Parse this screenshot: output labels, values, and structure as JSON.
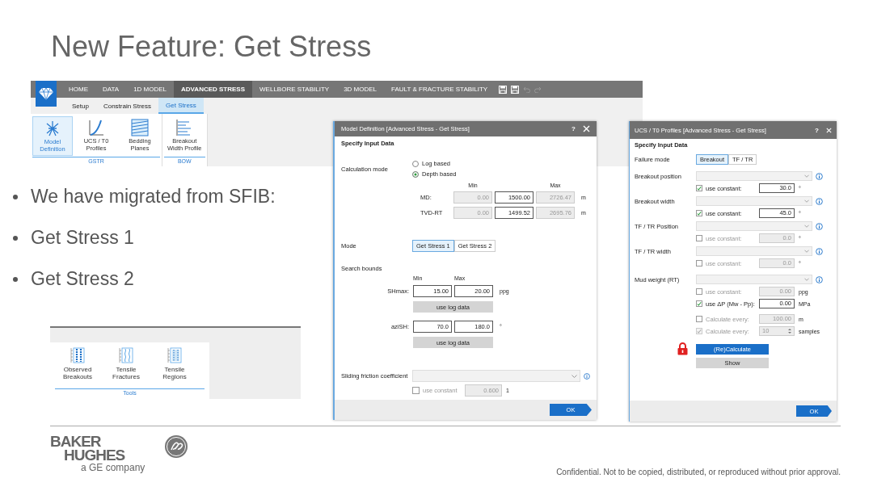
{
  "title": "New Feature: Get Stress",
  "bullets": [
    "We have migrated from SFIB:",
    "Get Stress 1",
    "Get Stress 2"
  ],
  "ribbon": {
    "tabs": [
      {
        "label": "HOME",
        "selected": false
      },
      {
        "label": "DATA",
        "selected": false
      },
      {
        "label": "1D MODEL",
        "selected": false
      },
      {
        "label": "ADVANCED STRESS",
        "selected": true
      },
      {
        "label": "WELLBORE STABILITY",
        "selected": false
      },
      {
        "label": "3D MODEL",
        "selected": false
      },
      {
        "label": "FAULT & FRACTURE STABILITY",
        "selected": false
      }
    ],
    "subtabs": [
      {
        "label": "Setup",
        "selected": false
      },
      {
        "label": "Constrain Stress",
        "selected": false
      },
      {
        "label": "Get Stress",
        "selected": true
      }
    ],
    "groups": [
      {
        "label": "GSTR",
        "items": [
          {
            "label": "Model\nDefinition",
            "kind": "model",
            "selected": true
          },
          {
            "label": "UCS / T0\nProfiles",
            "kind": "curve",
            "selected": false
          },
          {
            "label": "Bedding\nPlanes",
            "kind": "planes",
            "selected": false
          }
        ]
      },
      {
        "label": "BOW",
        "items": [
          {
            "label": "Breakout\nWidth Profile",
            "kind": "profile",
            "selected": false
          }
        ]
      }
    ]
  },
  "tools": {
    "label": "Tools",
    "items": [
      {
        "label": "Observed\nBreakouts",
        "kind": "breakouts"
      },
      {
        "label": "Tensile\nFractures",
        "kind": "fractures"
      },
      {
        "label": "Tensile\nRegions",
        "kind": "regions"
      }
    ]
  },
  "model_dialog": {
    "title": "Model Definition [Advanced Stress - Get Stress]",
    "help": "?",
    "heading": "Specify Input Data",
    "calc_label": "Calculation mode",
    "calc_options": [
      {
        "label": "Log based",
        "selected": false
      },
      {
        "label": "Depth based",
        "selected": true
      }
    ],
    "depth_headers": [
      "Min",
      "Max"
    ],
    "depth_rows": [
      {
        "label": "MD:",
        "values": [
          {
            "value": "0.00",
            "disabled": true
          },
          {
            "value": "1500.00",
            "disabled": false
          },
          {
            "value": "2726.47",
            "disabled": true
          }
        ],
        "unit": "m"
      },
      {
        "label": "TVD-RT",
        "values": [
          {
            "value": "0.00",
            "disabled": true
          },
          {
            "value": "1499.52",
            "disabled": false
          },
          {
            "value": "2695.76",
            "disabled": true
          }
        ],
        "unit": "m"
      }
    ],
    "mode_label": "Mode",
    "modes": [
      {
        "label": "Get Stress 1",
        "selected": true
      },
      {
        "label": "Get Stress 2",
        "selected": false
      }
    ],
    "bounds_label": "Search bounds",
    "bounds_headers": [
      "Min",
      "Max"
    ],
    "bounds": [
      {
        "label": "SHmax:",
        "min": "15.00",
        "max": "20.00",
        "unit": "ppg",
        "button": "use log data"
      },
      {
        "label": "aziSH:",
        "min": "70.0",
        "max": "180.0",
        "unit": "°",
        "button": "use log data"
      }
    ],
    "friction": {
      "label": "Sliding friction coefficient",
      "check_label": "use constant",
      "checked": false,
      "value": "0.600",
      "unit": "1"
    },
    "ok": "OK"
  },
  "profiles_dialog": {
    "title": "UCS / T0 Profiles [Advanced Stress - Get Stress]",
    "help": "?",
    "heading": "Specify Input Data",
    "failure_label": "Failure mode",
    "failure_modes": [
      {
        "label": "Breakout",
        "selected": true
      },
      {
        "label": "TF / TR",
        "selected": false
      }
    ],
    "params": [
      {
        "label": "Breakout position",
        "check_label": "use constant:",
        "checked": true,
        "value": "30.0",
        "unit": "°"
      },
      {
        "label": "Breakout width",
        "check_label": "use constant:",
        "checked": true,
        "value": "45.0",
        "unit": "°"
      },
      {
        "label": "TF / TR Position",
        "check_label": "use constant:",
        "checked": false,
        "value": "0.0",
        "unit": "°"
      },
      {
        "label": "TF / TR width",
        "check_label": "use constant:",
        "checked": false,
        "value": "0.0",
        "unit": "°"
      }
    ],
    "mud_label": "Mud weight (RT)",
    "mud_options": [
      {
        "label": "use constant:",
        "checked": false,
        "value": "0.00",
        "unit": "ppg"
      },
      {
        "label": "use ΔP (Mw - Pp):",
        "checked": true,
        "value": "0.00",
        "unit": "MPa"
      }
    ],
    "calc": [
      {
        "label": "Calculate every:",
        "kind": "field",
        "checked": false,
        "disabled": false,
        "value": "100.00",
        "unit": "m"
      },
      {
        "label": "Calculate every:",
        "kind": "spinner",
        "checked": true,
        "disabled": true,
        "value": "10",
        "unit": "samples"
      }
    ],
    "recalc": "(Re)Calculate",
    "show": "Show",
    "ok": "OK"
  },
  "footer": {
    "company": [
      "BAKER",
      "HUGHES"
    ],
    "tagline": "a GE company",
    "notice": "Confidential. Not to be copied, distributed, or reproduced without prior approval."
  }
}
